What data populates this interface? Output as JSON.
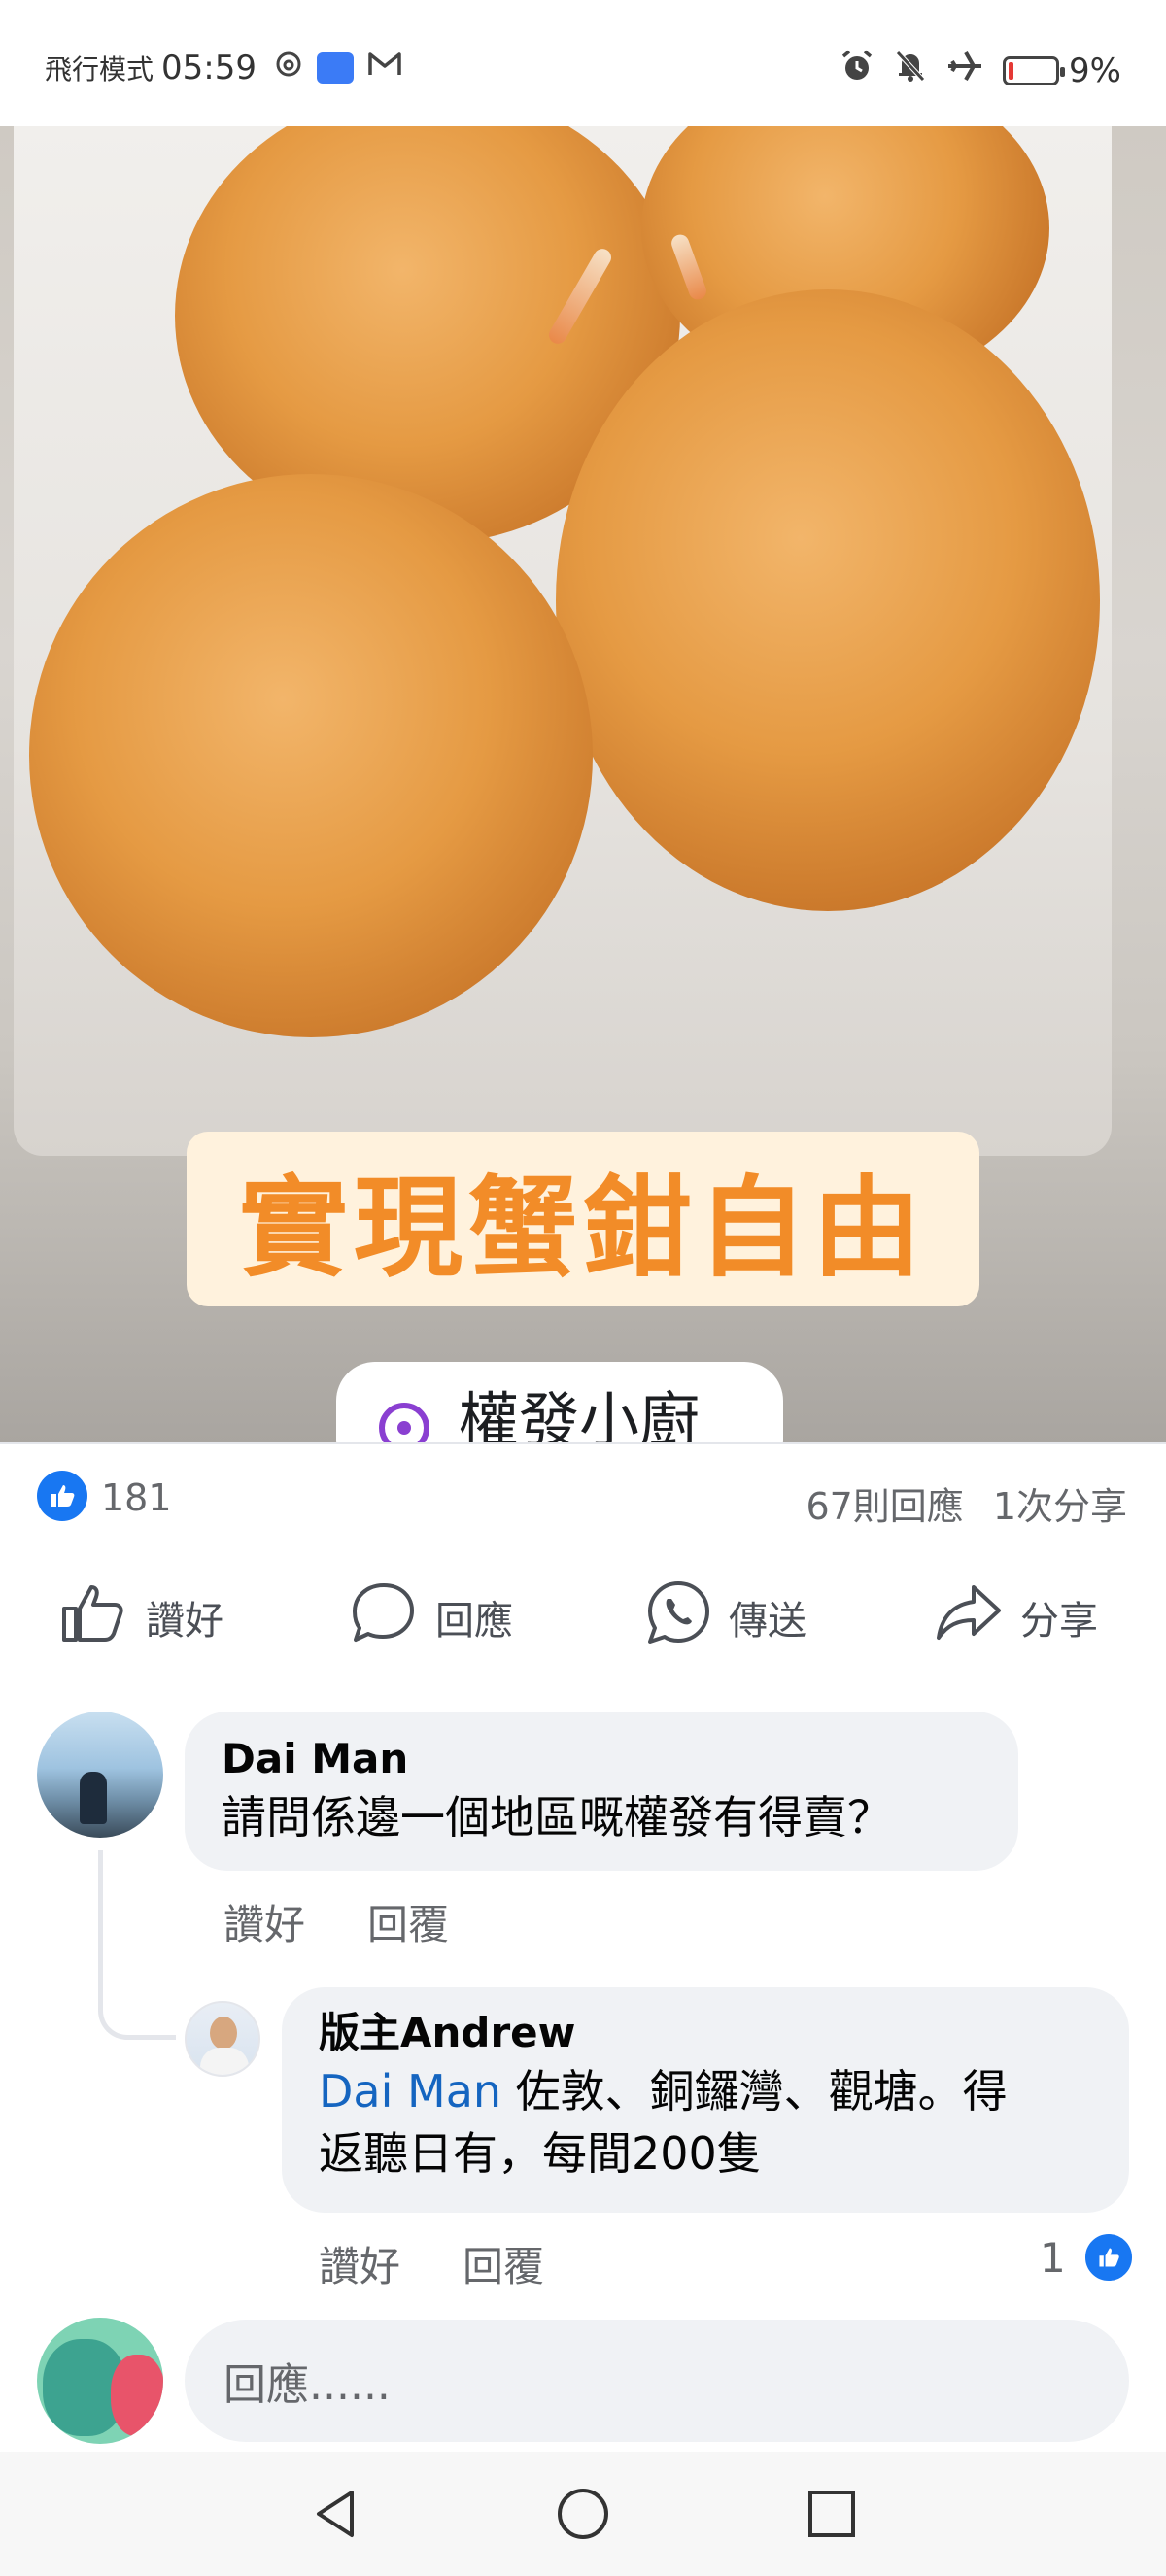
{
  "status_bar": {
    "mode": "飛行模式",
    "time": "05:59",
    "battery": "9%",
    "icons": [
      "threads-icon",
      "honor-icon",
      "gmail-icon",
      "alarm-icon",
      "mute-icon",
      "airplane-icon",
      "battery-icon"
    ]
  },
  "post": {
    "image_caption": "實現蟹鉗自由",
    "location_label": "權發小廚",
    "like_count": "181",
    "comments_count": "67則回應",
    "shares_count": "1次分享"
  },
  "actions": {
    "like": "讚好",
    "comment": "回應",
    "send": "傳送",
    "share": "分享"
  },
  "comments": [
    {
      "author": "Dai Man",
      "text": "請問係邊一個地區嘅權發有得賣？",
      "like_label": "讚好",
      "reply_label": "回覆"
    }
  ],
  "reply": {
    "author": "版主Andrew",
    "mention": "Dai Man",
    "text_line1": " 佐敦、銅鑼灣、觀塘。得",
    "text_line2": "返聽日有，每間200隻",
    "like_label": "讚好",
    "reply_label": "回覆",
    "likes": "1"
  },
  "comment_input": {
    "placeholder": "回應......"
  },
  "colors": {
    "accent": "#1877f2",
    "caption_text": "#f28c28",
    "caption_bg": "#fff2dd",
    "location_icon": "#8a3fd1"
  }
}
